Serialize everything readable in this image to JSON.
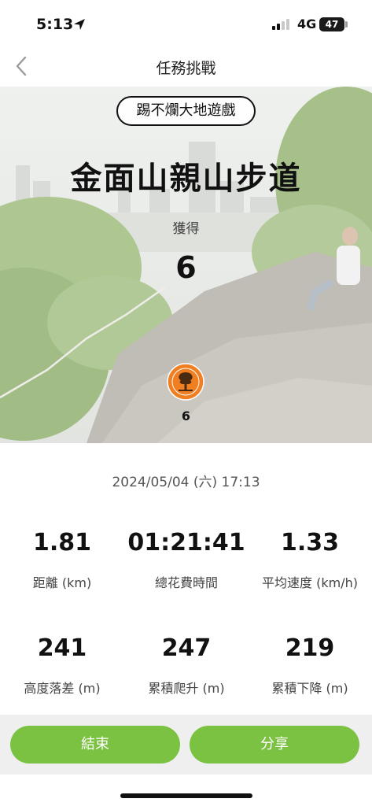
{
  "status_bar": {
    "time": "5:13",
    "network": "4G",
    "battery": "47",
    "battery_level": 0.47
  },
  "nav": {
    "title": "任務挑戰"
  },
  "hero": {
    "game_tag": "踢不爛大地遊戲",
    "trail_name": "金面山親山步道",
    "earn_label": "獲得",
    "earn_value": "6",
    "badge_count": "6",
    "badge_color": "#f07f22"
  },
  "record": {
    "date": "2024/05/04 (六) 17:13"
  },
  "stats": [
    {
      "value": "1.81",
      "label": "距離 (km)"
    },
    {
      "value": "01:21:41",
      "label": "總花費時間"
    },
    {
      "value": "1.33",
      "label": "平均速度 (km/h)"
    },
    {
      "value": "241",
      "label": "高度落差 (m)"
    },
    {
      "value": "247",
      "label": "累積爬升 (m)"
    },
    {
      "value": "219",
      "label": "累積下降 (m)"
    }
  ],
  "actions": {
    "end_label": "結束",
    "share_label": "分享",
    "accent_color": "#7cc242"
  }
}
